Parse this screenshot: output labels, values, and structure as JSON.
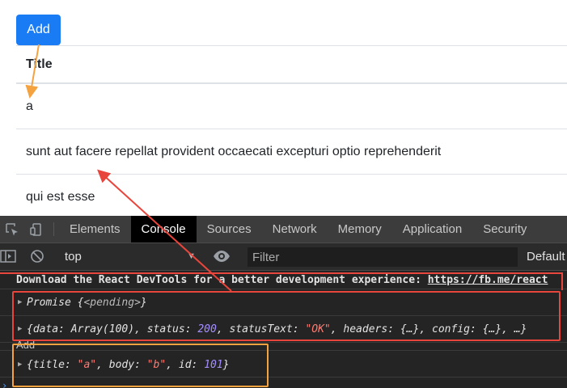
{
  "page": {
    "add_button": "Add",
    "table": {
      "header": "Title",
      "rows": [
        "a",
        "sunt aut facere repellat provident occaecati excepturi optio reprehenderit",
        "qui est esse"
      ]
    }
  },
  "devtools": {
    "tabs": [
      "Elements",
      "Console",
      "Sources",
      "Network",
      "Memory",
      "Application",
      "Security"
    ],
    "active_tab": "Console",
    "context": "top",
    "filter_placeholder": "Filter",
    "levels": "Default",
    "console": {
      "warning_text": "Download the React DevTools for a better development experience: ",
      "warning_url": "https://fb.me/react",
      "promise_label": "Promise",
      "promise_state": "<pending>",
      "response": {
        "data_key": "data",
        "data_val": "Array(100)",
        "status_key": "status",
        "status_val": "200",
        "statusText_key": "statusText",
        "statusText_val": "\"OK\"",
        "headers_key": "headers",
        "config_key": "config",
        "collapsed": "{…}",
        "ellipsis": "…"
      },
      "plain_log": "Add",
      "created": {
        "title_key": "title",
        "title_val": "\"a\"",
        "body_key": "body",
        "body_val": "\"b\"",
        "id_key": "id",
        "id_val": "101"
      }
    }
  },
  "colors": {
    "add_button": "#1a7cf5",
    "highlight_red": "#e8453c",
    "highlight_orange": "#f4a340"
  }
}
